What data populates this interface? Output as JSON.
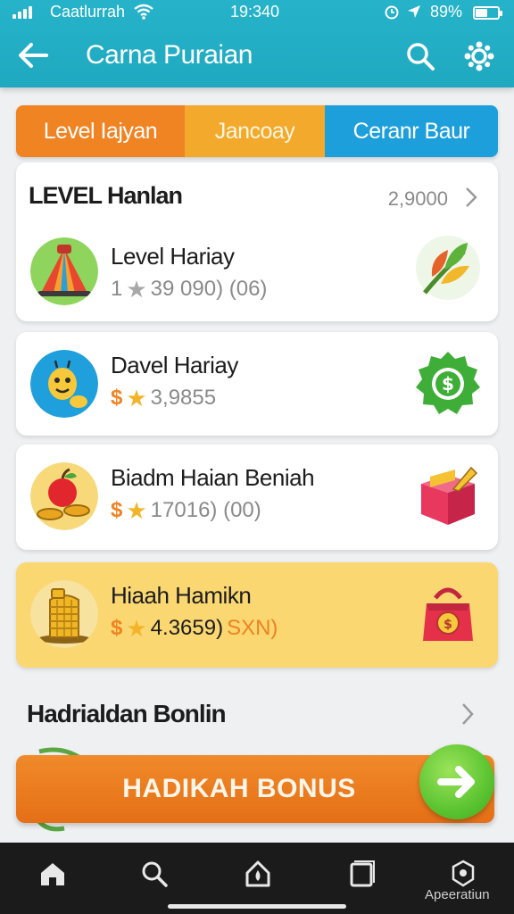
{
  "status_bar": {
    "carrier": "Caatlurrah",
    "time": "19:340",
    "battery": "89%"
  },
  "app_bar": {
    "title": "Carna Puraian",
    "icons": [
      "back-arrow-icon",
      "search-icon",
      "settings-icon"
    ]
  },
  "tabs": [
    {
      "label": "Level Iajyan",
      "color": "#f08322"
    },
    {
      "label": "Jancoay",
      "color": "#f2a92c"
    },
    {
      "label": "Ceranr Baur",
      "color": "#1d9fdc"
    }
  ],
  "level_section": {
    "title": "LEVEL Hanlan",
    "value": "2,9000"
  },
  "items": [
    {
      "title": "Level Hariay",
      "prefix": "1",
      "value": "39 090) (06)",
      "suffix": "",
      "icon": "tent-icon",
      "badge": "leaf-icon"
    },
    {
      "title": "Davel Hariay",
      "prefix": "$",
      "value": "3,9855",
      "suffix": "",
      "icon": "mascot-icon",
      "badge": "coin-seal-icon"
    },
    {
      "title": "Biadm Haian Beniah",
      "prefix": "$",
      "value": "17016) (00)",
      "suffix": "",
      "icon": "apple-coins-icon",
      "badge": "gift-box-icon"
    },
    {
      "title": "Hiaah Hamikn",
      "prefix": "$",
      "value": "4.3659)",
      "suffix": "SXN)",
      "icon": "coin-stack-icon",
      "badge": "money-bag-icon"
    }
  ],
  "bonus": {
    "heading": "Hadrialdan Bonlin",
    "button_label": "HADIKAH BONUS"
  },
  "bottom_nav": {
    "items": [
      "home-icon",
      "search-icon",
      "drop-icon",
      "square-icon",
      "app-icon"
    ],
    "label": "Apeeratiun"
  },
  "colors": {
    "header": "#22aec5",
    "orange": "#f08322",
    "gold": "#fbd772",
    "green": "#5cc431"
  }
}
